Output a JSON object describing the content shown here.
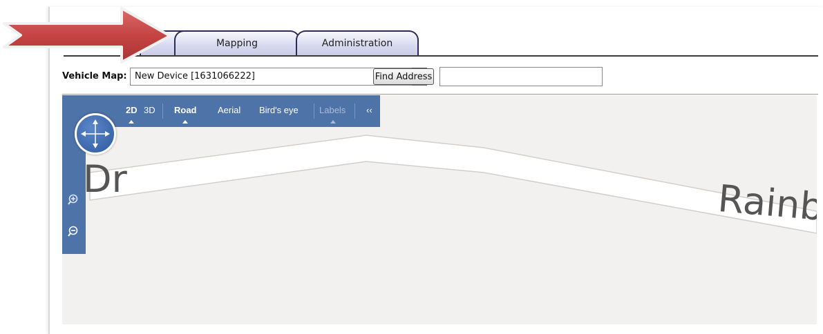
{
  "tabs": [
    {
      "label": ""
    },
    {
      "label": "Mapping"
    },
    {
      "label": "Administration"
    }
  ],
  "toolbar": {
    "vehicle_map_label": "Vehicle Map:",
    "vehicle_selected": "New Device [1631066222]",
    "find_address_label": "Find Address",
    "address_value": ""
  },
  "map": {
    "view_modes": {
      "mode_2d": "2D",
      "mode_3d": "3D",
      "road": "Road",
      "aerial": "Aerial",
      "birds_eye": "Bird's eye",
      "labels": "Labels",
      "collapse": "‹‹"
    },
    "street_label_left": "Dr",
    "street_label_right": "Rainbo"
  },
  "colors": {
    "tab_border": "#2e2a55",
    "map_control_bar": "#4e73a8",
    "map_background": "#f3f1ef",
    "arrow": "#c94b4b"
  },
  "icons": [
    "pan-compass-icon",
    "zoom-in-icon",
    "zoom-out-icon",
    "dropdown-arrow-icon",
    "pointer-arrow-icon"
  ]
}
